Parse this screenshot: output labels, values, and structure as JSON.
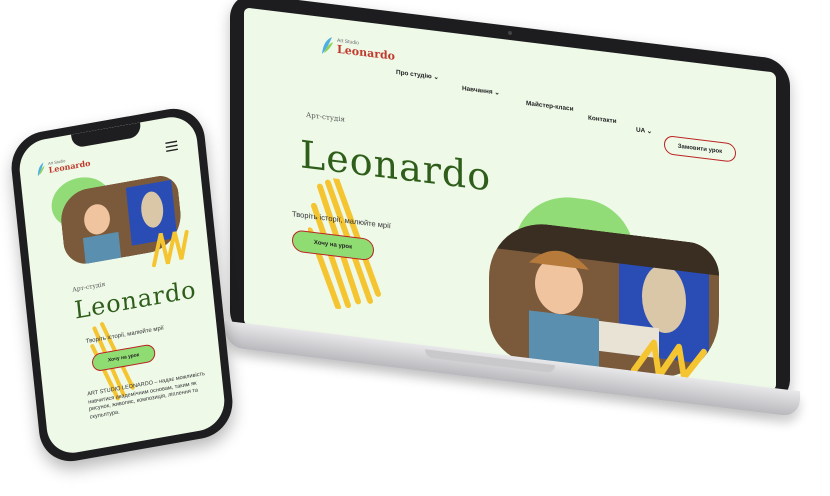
{
  "site": {
    "logo_small": "Art Studio",
    "logo_name": "Leonardo",
    "nav": [
      {
        "label": "Про студію",
        "has_dropdown": true
      },
      {
        "label": "Навчання",
        "has_dropdown": true
      },
      {
        "label": "Майстер-класи",
        "has_dropdown": false
      },
      {
        "label": "Контакти",
        "has_dropdown": false
      }
    ],
    "language": "UA",
    "order_button": "Замовити урок",
    "kicker": "Арт-студія",
    "hero_title": "Leonardo",
    "tagline": "Творіть історії, малюйте мрії",
    "cta_button": "Хочу на урок",
    "description": "ART STUDIO LEONARDO – надає можливість навчитися академічним основам, таким як рисунок, живопис, композиція, ліплення та скульптура."
  },
  "colors": {
    "bg": "#eef9e8",
    "accent_green": "#8fdc72",
    "title_green": "#2e5e1a",
    "brand_red": "#c0392b",
    "scribble_yellow": "#f5c531"
  },
  "icons": {
    "menu": "hamburger-icon",
    "dropdown": "chevron-down-icon",
    "feather": "feather-logo-icon"
  }
}
